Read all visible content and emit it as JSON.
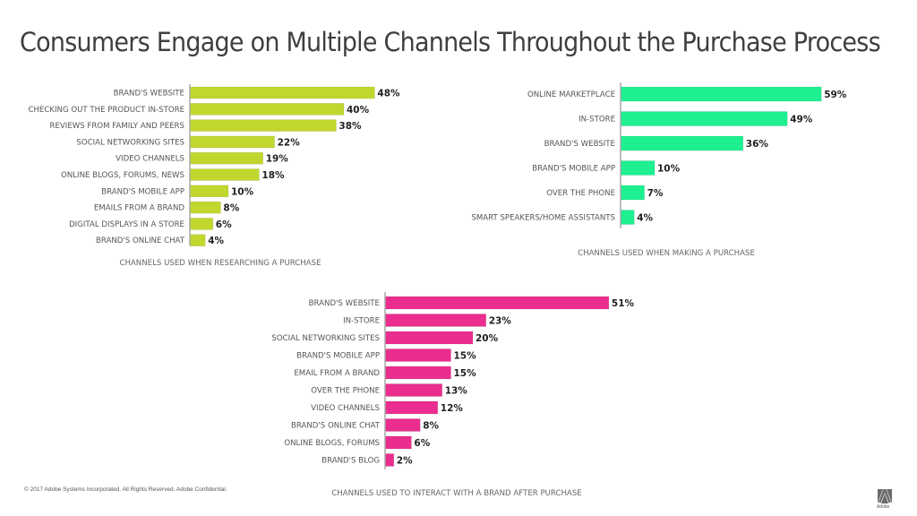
{
  "slide": {
    "title": "Consumers Engage on Multiple Channels Throughout the Purchase Process",
    "footer": "© 2017 Adobe Systems Incorporated.  All Rights Reserved.  Adobe Confidential.",
    "logo_text": "Adobe",
    "logo_icon": "adobe-logo-icon"
  },
  "chart_data": [
    {
      "type": "bar",
      "orientation": "horizontal",
      "title": "CHANNELS USED WHEN RESEARCHING A PURCHASE",
      "color": "#c1d72e",
      "categories": [
        "BRAND'S WEBSITE",
        "CHECKING OUT THE PRODUCT IN-STORE",
        "REVIEWS FROM FAMILY AND PEERS",
        "SOCIAL NETWORKING SITES",
        "VIDEO CHANNELS",
        "ONLINE BLOGS, FORUMS, NEWS",
        "BRAND'S MOBILE APP",
        "EMAILS FROM A BRAND",
        "DIGITAL DISPLAYS IN A STORE",
        "BRAND'S ONLINE CHAT"
      ],
      "values": [
        48,
        40,
        38,
        22,
        19,
        18,
        10,
        8,
        6,
        4
      ],
      "value_labels": [
        "48%",
        "40%",
        "38%",
        "22%",
        "19%",
        "18%",
        "10%",
        "8%",
        "6%",
        "4%"
      ],
      "unit": "%",
      "grid": false
    },
    {
      "type": "bar",
      "orientation": "horizontal",
      "title": "CHANNELS USED WHEN  MAKING A PURCHASE",
      "color": "#1ef091",
      "categories": [
        "ONLINE MARKETPLACE",
        "IN-STORE",
        "BRAND'S WEBSITE",
        "BRAND'S MOBILE APP",
        "OVER THE PHONE",
        "SMART SPEAKERS/HOME ASSISTANTS"
      ],
      "values": [
        59,
        49,
        36,
        10,
        7,
        4
      ],
      "value_labels": [
        "59%",
        "49%",
        "36%",
        "10%",
        "7%",
        "4%"
      ],
      "unit": "%",
      "grid": false
    },
    {
      "type": "bar",
      "orientation": "horizontal",
      "title": "CHANNELS USED TO INTERACT WITH A BRAND AFTER PURCHASE",
      "color": "#ea2d8e",
      "categories": [
        "BRAND'S WEBSITE",
        "IN-STORE",
        "SOCIAL NETWORKING SITES",
        "BRAND'S MOBILE APP",
        "EMAIL FROM A BRAND",
        "OVER THE PHONE",
        "VIDEO CHANNELS",
        "BRAND'S ONLINE CHAT",
        "ONLINE BLOGS, FORUMS",
        "BRAND'S BLOG"
      ],
      "values": [
        51,
        23,
        20,
        15,
        15,
        13,
        12,
        8,
        6,
        2
      ],
      "value_labels": [
        "51%",
        "23%",
        "20%",
        "15%",
        "15%",
        "13%",
        "12%",
        "8%",
        "6%",
        "2%"
      ],
      "unit": "%",
      "grid": false
    }
  ]
}
